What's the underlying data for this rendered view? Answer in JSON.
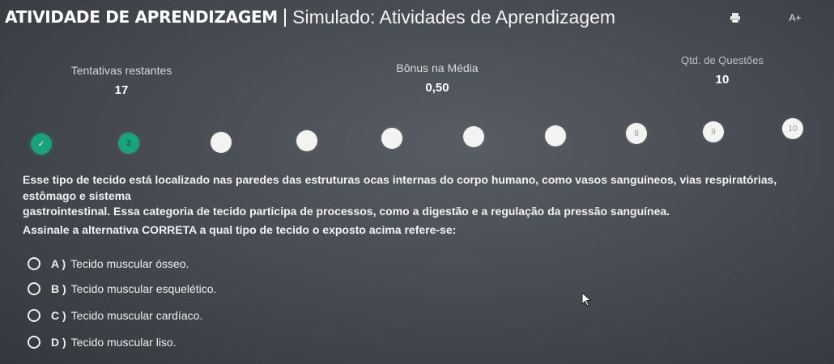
{
  "header": {
    "brand": "ATIVIDADE DE APRENDIZAGEM",
    "separator": "|",
    "title": "Simulado: Atividades de Aprendizagem",
    "print_icon": "print-icon",
    "font_size_label": "A+"
  },
  "stats": {
    "attempts_label": "Tentativas restantes",
    "attempts_value": "17",
    "bonus_label": "Bônus na Média",
    "bonus_value": "0,50",
    "questions_label": "Qtd. de Questões",
    "questions_value": "10"
  },
  "progress": {
    "answered_color": "#18a37d",
    "pending_color": "#f3f3f1",
    "steps": [
      {
        "label": "✓",
        "state": "answered"
      },
      {
        "label": "2",
        "state": "current"
      },
      {
        "label": "",
        "state": "pending"
      },
      {
        "label": "",
        "state": "pending"
      },
      {
        "label": "",
        "state": "pending"
      },
      {
        "label": "",
        "state": "pending"
      },
      {
        "label": "",
        "state": "pending"
      },
      {
        "label": "8",
        "state": "pending"
      },
      {
        "label": "9",
        "state": "pending"
      },
      {
        "label": "10",
        "state": "pending"
      }
    ]
  },
  "question": {
    "line1": "Esse tipo de tecido está localizado nas paredes das estruturas ocas internas do corpo humano, como vasos sanguíneos, vias respiratórias, estômago e sistema",
    "line2": "gastrointestinal. Essa categoria de tecido participa de processos, como a digestão e a regulação da pressão sanguínea.",
    "line3": "Assinale a alternativa CORRETA a qual tipo de tecido o exposto acima refere-se:"
  },
  "options": [
    {
      "letter": "A )",
      "text": "Tecido muscular ósseo."
    },
    {
      "letter": "B )",
      "text": "Tecido muscular esquelético."
    },
    {
      "letter": "C )",
      "text": "Tecido muscular cardíaco."
    },
    {
      "letter": "D )",
      "text": "Tecido muscular liso."
    }
  ]
}
